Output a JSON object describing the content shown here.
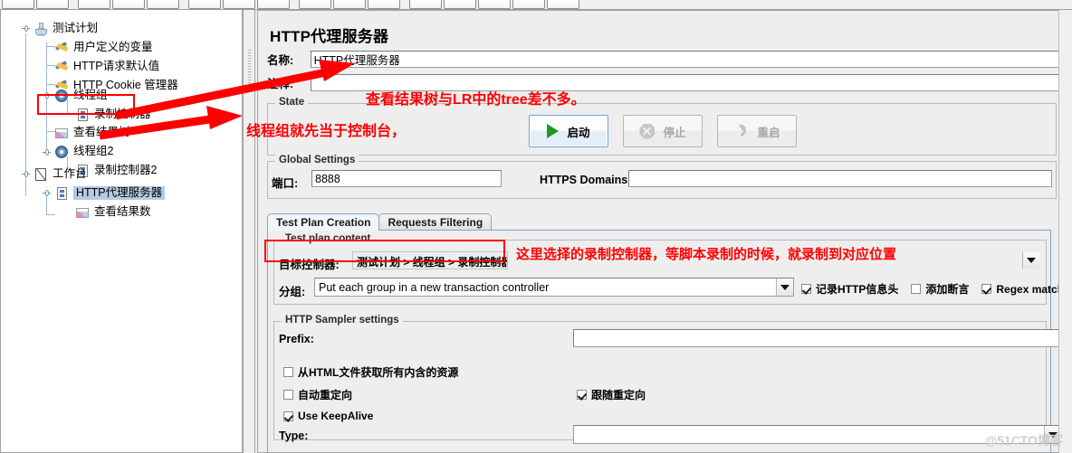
{
  "toolbar": {
    "button_count": 17
  },
  "tree": {
    "nodes": [
      {
        "label": "测试计划",
        "icon": "test-plan-icon",
        "depth": 0,
        "selected": false
      },
      {
        "label": "用户定义的变量",
        "icon": "wrench-icon",
        "depth": 1,
        "selected": false
      },
      {
        "label": "HTTP请求默认值",
        "icon": "wrench-icon",
        "depth": 1,
        "selected": false
      },
      {
        "label": "HTTP Cookie 管理器",
        "icon": "wrench-icon",
        "depth": 1,
        "selected": false
      },
      {
        "label": "线程组",
        "icon": "gear-icon",
        "depth": 1,
        "selected": false
      },
      {
        "label": "录制控制器",
        "icon": "controller-icon",
        "depth": 2,
        "selected": false
      },
      {
        "label": "查看结果树",
        "icon": "result-tree-icon",
        "depth": 1,
        "selected": false
      },
      {
        "label": "线程组2",
        "icon": "gear-icon",
        "depth": 1,
        "selected": false
      },
      {
        "label": "录制控制器2",
        "icon": "controller-icon",
        "depth": 2,
        "selected": false
      },
      {
        "label": "工作台",
        "icon": "workbench-icon",
        "depth": 0,
        "selected": false
      },
      {
        "label": "HTTP代理服务器",
        "icon": "controller-icon",
        "depth": 1,
        "selected": true
      },
      {
        "label": "查看结果数",
        "icon": "result-tree-icon",
        "depth": 2,
        "selected": false
      }
    ]
  },
  "panel": {
    "title": "HTTP代理服务器",
    "name_label": "名称:",
    "name_value": "HTTP代理服务器",
    "comment_label": "注释:",
    "comment_value": ""
  },
  "state": {
    "legend": "State",
    "start_label": "启动",
    "stop_label": "停止",
    "restart_label": "重启"
  },
  "global_settings": {
    "legend": "Global Settings",
    "port_label": "端口:",
    "port_value": "8888",
    "https_domains_label": "HTTPS Domains :",
    "https_domains_value": ""
  },
  "tabs": [
    {
      "label": "Test Plan Creation",
      "active": true
    },
    {
      "label": "Requests Filtering",
      "active": false
    }
  ],
  "test_plan_content": {
    "legend": "Test plan content",
    "target_controller_label": "目标控制器:",
    "target_controller_value": "测试计划 > 线程组 > 录制控制器",
    "grouping_label": "分组:",
    "grouping_value": "Put each group in a new transaction controller",
    "checkboxes": [
      {
        "label": "记录HTTP信息头",
        "checked": true
      },
      {
        "label": "添加断言",
        "checked": false
      },
      {
        "label": "Regex matching",
        "checked": true
      }
    ]
  },
  "http_sampler_settings": {
    "legend": "HTTP Sampler settings",
    "prefix_label": "Prefix:",
    "prefix_value": "",
    "retrieve_resources": {
      "label": "从HTML文件获取所有内含的资源",
      "checked": false
    },
    "auto_redirect": {
      "label": "自动重定向",
      "checked": false
    },
    "follow_redirect": {
      "label": "跟随重定向",
      "checked": true
    },
    "use_keepalive": {
      "label": "Use KeepAlive",
      "checked": true
    },
    "type_label": "Type:",
    "type_value": ""
  },
  "annotations": [
    {
      "text": "查看结果树与LR中的tree差不多。",
      "color": "#ff0000"
    },
    {
      "text": "线程组就先当于控制台，",
      "color": "#ff0000"
    },
    {
      "text": "这里选择的录制控制器，等脚本录制的时候，就录制到对应位置",
      "color": "#ff0000"
    }
  ],
  "watermark": "@51CTO博客",
  "colors": {
    "annotation_red": "#ff0000",
    "selection_blue": "#b5cbe3",
    "panel_bg": "#eeeeee",
    "tab_active_border": "#7fa4c9",
    "play_green": "#1d9a1d"
  }
}
